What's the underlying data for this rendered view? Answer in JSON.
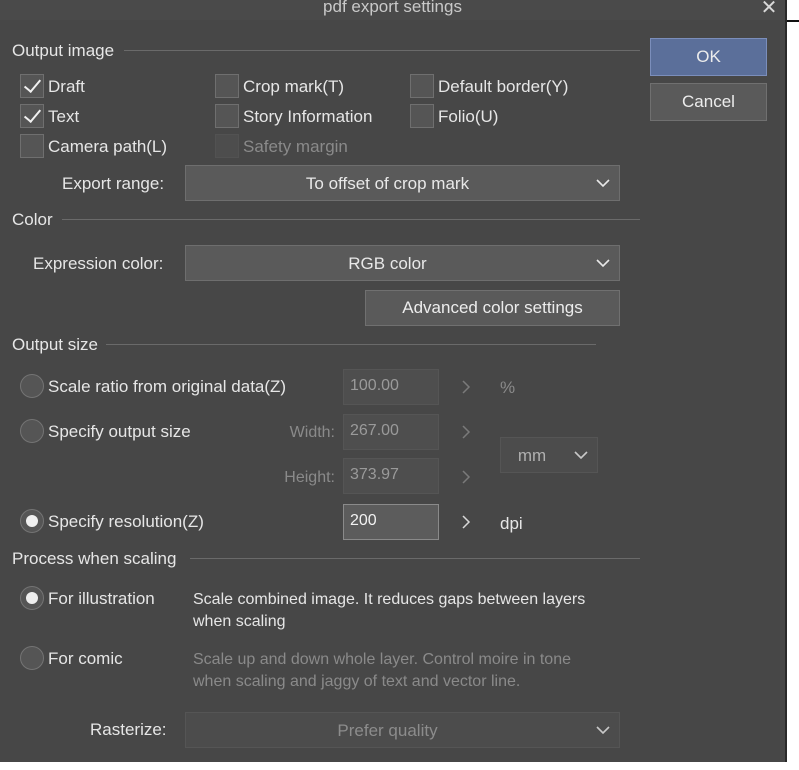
{
  "window": {
    "title": "pdf export settings",
    "close_glyph": "✕"
  },
  "buttons": {
    "ok": "OK",
    "cancel": "Cancel",
    "advanced_color": "Advanced color settings"
  },
  "output_image": {
    "section": "Output image",
    "options": {
      "draft": {
        "label": "Draft",
        "checked": true
      },
      "crop_mark": {
        "label": "Crop mark(T)",
        "checked": false
      },
      "default_border": {
        "label": "Default border(Y)",
        "checked": false
      },
      "text": {
        "label": "Text",
        "checked": true
      },
      "story_info": {
        "label": "Story Information",
        "checked": false
      },
      "folio": {
        "label": "Folio(U)",
        "checked": false
      },
      "camera_path": {
        "label": "Camera path(L)",
        "checked": false
      },
      "safety_margin": {
        "label": "Safety margin",
        "checked": false,
        "disabled": true
      }
    },
    "export_range": {
      "label": "Export range:",
      "value": "To offset of crop mark"
    }
  },
  "color": {
    "section": "Color",
    "expression": {
      "label": "Expression color:",
      "value": "RGB color"
    }
  },
  "output_size": {
    "section": "Output size",
    "scale_ratio": {
      "label": "Scale ratio from original data(Z)",
      "value": "100.00",
      "unit": "%"
    },
    "specify_size": {
      "label": "Specify output size",
      "width_label": "Width:",
      "width": "267.00",
      "height_label": "Height:",
      "height": "373.97",
      "unit": "mm"
    },
    "specify_resolution": {
      "label": "Specify resolution(Z)",
      "value": "200",
      "unit": "dpi"
    },
    "selected": "specify_resolution"
  },
  "scaling": {
    "section": "Process when scaling",
    "illustration": {
      "label": "For illustration",
      "desc": "Scale combined image. It reduces gaps between layers when scaling"
    },
    "comic": {
      "label": "For comic",
      "desc": "Scale up and down whole layer. Control moire in tone when scaling and jaggy of text and vector line."
    },
    "selected": "illustration",
    "rasterize": {
      "label": "Rasterize:",
      "value": "Prefer quality"
    }
  },
  "colors": {
    "panel": "#474747",
    "primary_button": "#5b6f9a",
    "text": "#e6e6e6",
    "dim_text": "#8a8a8a"
  },
  "icons": [
    "close-icon",
    "check-icon",
    "chevron-down-icon",
    "chevron-right-icon"
  ]
}
